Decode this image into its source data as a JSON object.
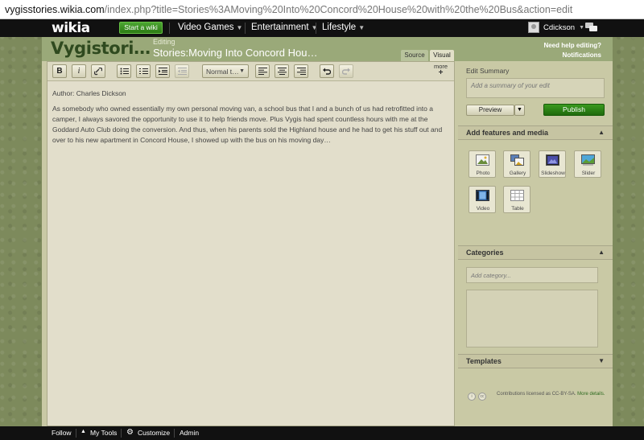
{
  "browser": {
    "url_host": "vygisstories.wikia.com",
    "url_path": "/index.php?title=Stories%3AMoving%20Into%20Concord%20House%20with%20the%20Bus&action=edit"
  },
  "globalnav": {
    "logo": "wikia",
    "start_wiki": "Start a wiki",
    "hubs": [
      {
        "label": "Video Games"
      },
      {
        "label": "Entertainment"
      },
      {
        "label": "Lifestyle"
      }
    ],
    "username": "Cdickson"
  },
  "header": {
    "wordmark": "Vygistori…",
    "editing_label": "Editing",
    "page_title": "Stories:Moving Into Concord Hou…",
    "tab_source": "Source",
    "tab_visual": "Visual",
    "help_link": "Need help editing?",
    "notifications": "Notifications"
  },
  "toolbar": {
    "bold": "B",
    "italic": "i",
    "format_value": "Normal t…",
    "more_label": "more",
    "more_plus": "+"
  },
  "content": {
    "author_line": "Author: Charles Dickson",
    "paragraph": "As somebody who owned essentially my own personal moving van, a school bus that I and a bunch of us had retrofitted into a camper, I always savored the opportunity to use it to help friends move.  Plus Vygis had spent countless hours with me at the Goddard Auto Club doing the conversion.  And thus, when his parents sold the Highland house and he had to get his stuff out and over to his new apartment in Concord House, I showed up with the bus on his moving day…"
  },
  "rail": {
    "summary_title": "Edit Summary",
    "summary_placeholder": "Add a summary of your edit",
    "preview_label": "Preview",
    "publish_label": "Publish",
    "features_title": "Add features and media",
    "features": [
      {
        "label": "Photo"
      },
      {
        "label": "Gallery"
      },
      {
        "label": "Slideshow"
      },
      {
        "label": "Slider"
      },
      {
        "label": "Video"
      },
      {
        "label": "Table"
      }
    ],
    "categories_title": "Categories",
    "category_placeholder": "Add category...",
    "templates_title": "Templates",
    "license_text": "Contributions licensed as CC-BY-SA.",
    "license_more": "More details."
  },
  "bottombar": {
    "follow": "Follow",
    "my_tools": "My Tools",
    "customize": "Customize",
    "admin": "Admin"
  }
}
